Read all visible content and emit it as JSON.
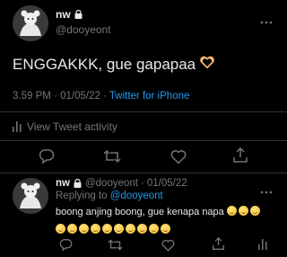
{
  "main_tweet": {
    "author_name": "nw",
    "handle": "@dooyeont",
    "text": "ENGGAKKK, gue gapapaa",
    "emoji": "heart-hands",
    "time": "3.59 PM",
    "separator": "·",
    "date": "01/05/22",
    "source": "Twitter for iPhone",
    "activity_label": "View Tweet activity"
  },
  "reply_tweet": {
    "author_name": "nw",
    "handle": "@dooyeont",
    "separator": "·",
    "date": "01/05/22",
    "replying_prefix": "Replying to",
    "replying_handle": "@dooyeont",
    "text": "boong anjing boong, gue kenapa napa",
    "emoji_count_line1": 3,
    "emoji_count_line2": 10
  },
  "colors": {
    "background": "#000000",
    "text": "#e7e9ea",
    "secondary": "#71767b",
    "accent": "#1d9bf0"
  },
  "icons": [
    "lock-icon",
    "more-icon",
    "reply-icon",
    "retweet-icon",
    "like-icon",
    "share-icon",
    "analytics-icon"
  ]
}
